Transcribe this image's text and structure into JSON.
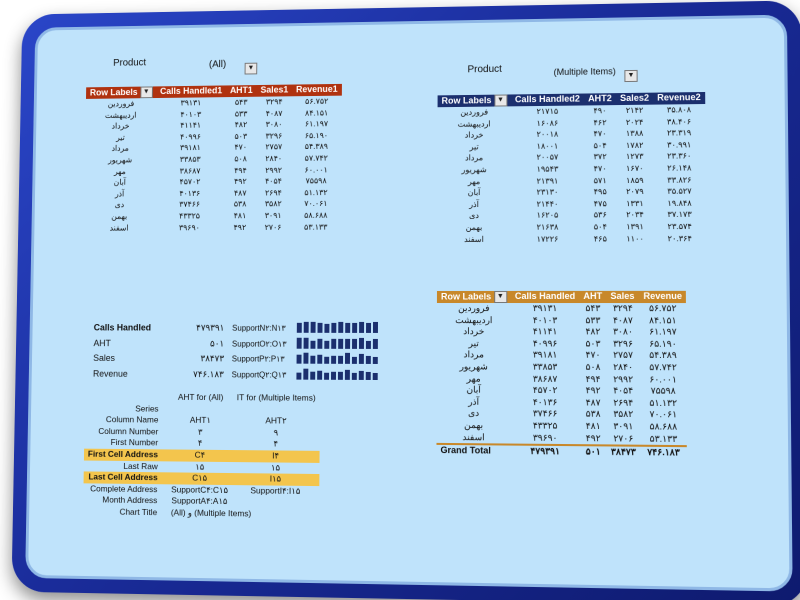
{
  "pivot1": {
    "filter_label": "Product",
    "filter_value": "(All)",
    "headers": [
      "Row Labels",
      "Calls Handled1",
      "AHT1",
      "Sales1",
      "Revenue1"
    ],
    "rows": [
      [
        "فروردين",
        "۳۹۱۳۱",
        "۵۴۳",
        "۳۲۹۴",
        "۵۶.۷۵۲"
      ],
      [
        "ارديبهشت",
        "۴۰۱۰۳",
        "۵۳۳",
        "۴۰۸۷",
        "۸۴.۱۵۱"
      ],
      [
        "خرداد",
        "۴۱۱۴۱",
        "۴۸۲",
        "۳۰۸۰",
        "۶۱.۱۹۷"
      ],
      [
        "تير",
        "۴۰۹۹۶",
        "۵۰۳",
        "۳۲۹۶",
        "۶۵.۱۹۰"
      ],
      [
        "مرداد",
        "۳۹۱۸۱",
        "۴۷۰",
        "۲۷۵۷",
        "۵۴.۳۸۹"
      ],
      [
        "شهريور",
        "۳۳۸۵۳",
        "۵۰۸",
        "۲۸۴۰",
        "۵۷.۷۴۲"
      ],
      [
        "مهر",
        "۳۸۶۸۷",
        "۴۹۴",
        "۲۹۹۲",
        "۶۰.۰۰۱"
      ],
      [
        "آبان",
        "۴۵۷۰۲",
        "۴۹۲",
        "۴۰۵۴",
        "۷۵۵۹۸"
      ],
      [
        "آذر",
        "۴۰۱۳۶",
        "۴۸۷",
        "۲۶۹۴",
        "۵۱.۱۳۲"
      ],
      [
        "دى",
        "۳۷۴۶۶",
        "۵۳۸",
        "۳۵۸۲",
        "۷۰.۰۶۱"
      ],
      [
        "بهمن",
        "۴۳۳۲۵",
        "۴۸۱",
        "۳۰۹۱",
        "۵۸.۶۸۸"
      ],
      [
        "اسفند",
        "۳۹۶۹۰",
        "۴۹۲",
        "۲۷۰۶",
        "۵۳.۱۳۳"
      ]
    ]
  },
  "pivot2": {
    "filter_label": "Product",
    "filter_value": "(Multiple Items)",
    "headers": [
      "Row Labels",
      "Calls Handled2",
      "AHT2",
      "Sales2",
      "Revenue2"
    ],
    "rows": [
      [
        "فروردين",
        "۲۱۷۱۵",
        "۴۹۰",
        "۲۱۴۲",
        "۳۵.۸۰۸"
      ],
      [
        "ارديبهشت",
        "۱۶۰۸۶",
        "۴۶۲",
        "۲۰۲۴",
        "۳۸.۴۰۶"
      ],
      [
        "خرداد",
        "۲۰۰۱۸",
        "۴۷۰",
        "۱۳۸۸",
        "۲۳.۳۱۹"
      ],
      [
        "تير",
        "۱۸۰۰۱",
        "۵۰۴",
        "۱۷۸۲",
        "۳۰.۹۹۱"
      ],
      [
        "مرداد",
        "۲۰۰۵۷",
        "۳۷۲",
        "۱۲۷۳",
        "۲۳.۳۶۰"
      ],
      [
        "شهريور",
        "۱۹۵۴۳",
        "۴۷۰",
        "۱۶۷۰",
        "۲۶.۱۴۸"
      ],
      [
        "مهر",
        "۲۱۳۹۱",
        "۵۷۱",
        "۱۸۵۹",
        "۳۳.۸۲۶"
      ],
      [
        "آبان",
        "۲۳۱۳۰",
        "۴۹۵",
        "۲۰۷۹",
        "۳۵.۵۲۷"
      ],
      [
        "آذر",
        "۲۱۴۴۰",
        "۴۷۵",
        "۱۳۳۱",
        "۱۹.۸۴۸"
      ],
      [
        "دى",
        "۱۶۲۰۵",
        "۵۳۶",
        "۲۰۳۴",
        "۳۷.۱۷۳"
      ],
      [
        "بهمن",
        "۲۱۶۳۸",
        "۵۰۴",
        "۱۳۹۱",
        "۲۳.۵۷۴"
      ],
      [
        "اسفند",
        "۱۷۲۲۶",
        "۴۶۵",
        "۱۱۰۰",
        "۲۰.۳۶۴"
      ]
    ]
  },
  "pivot3": {
    "headers": [
      "Row Labels",
      "Calls Handled",
      "AHT",
      "Sales",
      "Revenue"
    ],
    "rows": [
      [
        "فروردين",
        "۳۹۱۳۱",
        "۵۴۳",
        "۳۲۹۴",
        "۵۶.۷۵۲"
      ],
      [
        "ارديبهشت",
        "۴۰۱۰۳",
        "۵۳۳",
        "۴۰۸۷",
        "۸۴.۱۵۱"
      ],
      [
        "خرداد",
        "۴۱۱۴۱",
        "۴۸۲",
        "۳۰۸۰",
        "۶۱.۱۹۷"
      ],
      [
        "تير",
        "۴۰۹۹۶",
        "۵۰۳",
        "۳۲۹۶",
        "۶۵.۱۹۰"
      ],
      [
        "مرداد",
        "۳۹۱۸۱",
        "۴۷۰",
        "۲۷۵۷",
        "۵۴.۳۸۹"
      ],
      [
        "شهريور",
        "۳۳۸۵۳",
        "۵۰۸",
        "۲۸۴۰",
        "۵۷.۷۴۲"
      ],
      [
        "مهر",
        "۳۸۶۸۷",
        "۴۹۴",
        "۲۹۹۲",
        "۶۰.۰۰۱"
      ],
      [
        "آبان",
        "۴۵۷۰۲",
        "۴۹۲",
        "۴۰۵۴",
        "۷۵۵۹۸"
      ],
      [
        "آذر",
        "۴۰۱۳۶",
        "۴۸۷",
        "۲۶۹۴",
        "۵۱.۱۳۲"
      ],
      [
        "دى",
        "۳۷۴۶۶",
        "۵۳۸",
        "۳۵۸۲",
        "۷۰.۰۶۱"
      ],
      [
        "بهمن",
        "۴۳۳۲۵",
        "۴۸۱",
        "۳۰۹۱",
        "۵۸.۶۸۸"
      ],
      [
        "اسفند",
        "۳۹۶۹۰",
        "۴۹۲",
        "۲۷۰۶",
        "۵۳.۱۳۳"
      ]
    ],
    "total": [
      "Grand Total",
      "۴۷۹۳۹۱",
      "۵۰۱",
      "۳۸۴۷۳",
      "۷۴۶.۱۸۳"
    ]
  },
  "summary": {
    "rows": [
      {
        "label": "Calls Handled",
        "value": "۴۷۹۳۹۱",
        "ref": "SupportN۲:N۱۳",
        "spark": [
          9,
          10,
          10,
          9,
          8,
          9,
          10,
          9,
          9,
          10,
          9,
          10
        ],
        "bold": true
      },
      {
        "label": "AHT",
        "value": "۵۰۱",
        "ref": "SupportO۲:O۱۳",
        "spark": [
          8,
          8,
          6,
          7,
          6,
          7,
          7,
          7,
          7,
          8,
          6,
          7
        ],
        "bold": false
      },
      {
        "label": "Sales",
        "value": "۳۸۴۷۳",
        "ref": "SupportP۲:P۱۳",
        "spark": [
          8,
          10,
          7,
          8,
          6,
          7,
          7,
          10,
          6,
          9,
          7,
          6
        ],
        "bold": false
      },
      {
        "label": "Revenue",
        "value": "۷۴۶.۱۸۳",
        "ref": "SupportQ۲:Q۱۳",
        "spark": [
          6,
          10,
          7,
          8,
          6,
          7,
          7,
          9,
          6,
          8,
          7,
          6
        ],
        "bold": false
      }
    ]
  },
  "series_panel": {
    "col1_header": "AHT for (All)",
    "col2_header": "IT for (Multiple Items)",
    "rows": [
      {
        "label": "Series",
        "v1": "",
        "v2": "",
        "hl": false
      },
      {
        "label": "Column Name",
        "v1": "AHT۱",
        "v2": "AHT۲",
        "hl": false
      },
      {
        "label": "Column Number",
        "v1": "۳",
        "v2": "۹",
        "hl": false
      },
      {
        "label": "First Number",
        "v1": "۴",
        "v2": "۴",
        "hl": false
      },
      {
        "label": "First Cell Address",
        "v1": "C۴",
        "v2": "I۴",
        "hl": true
      },
      {
        "label": "Last Raw",
        "v1": "۱۵",
        "v2": "۱۵",
        "hl": false
      },
      {
        "label": "Last Cell Address",
        "v1": "C۱۵",
        "v2": "I۱۵",
        "hl": true
      },
      {
        "label": "Complete Address",
        "v1": "SupportC۴:C۱۵",
        "v2": "SupportI۴:I۱۵",
        "hl": false
      },
      {
        "label": "Month Address",
        "v1": "SupportA۴:A۱۵",
        "v2": "",
        "hl": false
      },
      {
        "label": "Chart Title",
        "v1": "(All)  و  (Multiple Items)",
        "v2": "",
        "hl": false
      }
    ]
  },
  "colors": {
    "bg": "#bfe3fb",
    "red": "#b0320f",
    "navy": "#1b2f6e",
    "gold": "#c8882a",
    "highlight": "#f3c54d"
  },
  "icons": {
    "dropdown": "chevron-down-icon"
  }
}
